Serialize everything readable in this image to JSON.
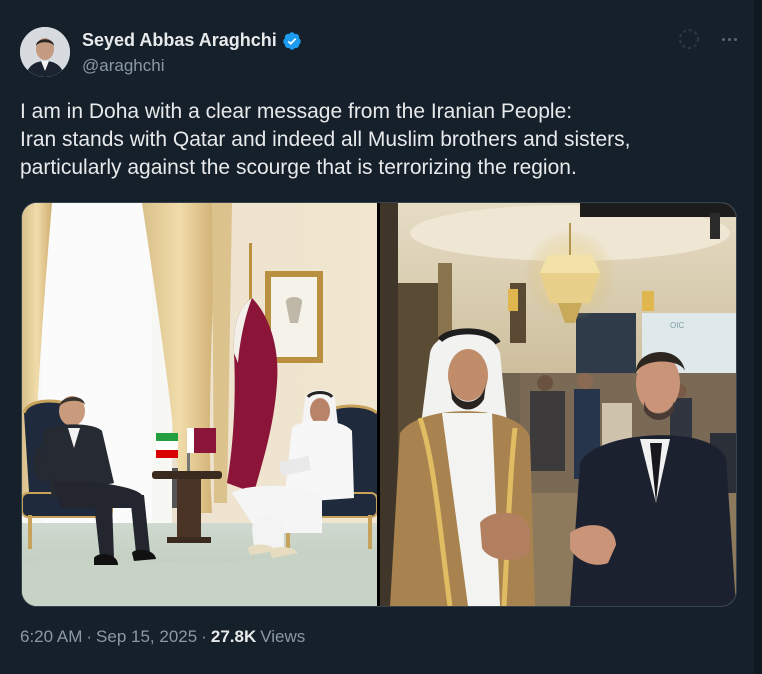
{
  "author": {
    "display_name": "Seyed Abbas Araghchi",
    "handle": "@araghchi",
    "verified": true,
    "verified_color": "#1d9bf0"
  },
  "tweet": {
    "lines": [
      "I am in Doha with a clear message from the Iranian People:",
      "Iran stands with Qatar and indeed all Muslim brothers and sisters,",
      "particularly against the scourge that is terrorizing the region."
    ]
  },
  "media": {
    "photos": [
      {
        "subject": "formal meeting, two men seated with Iranian and Qatari flags"
      },
      {
        "subject": "two men in conference hall under chandelier"
      }
    ]
  },
  "meta": {
    "time": "6:20 AM",
    "sep1": "·",
    "date": "Sep 15, 2025",
    "sep2": "·",
    "views_count": "27.8K",
    "views_label": "Views"
  },
  "colors": {
    "background": "#15202b",
    "text": "#e7e9ea",
    "secondary": "#8b98a5",
    "border": "#38444d"
  },
  "icons": [
    "verified-badge-icon",
    "more-options-icon",
    "grok-icon"
  ]
}
